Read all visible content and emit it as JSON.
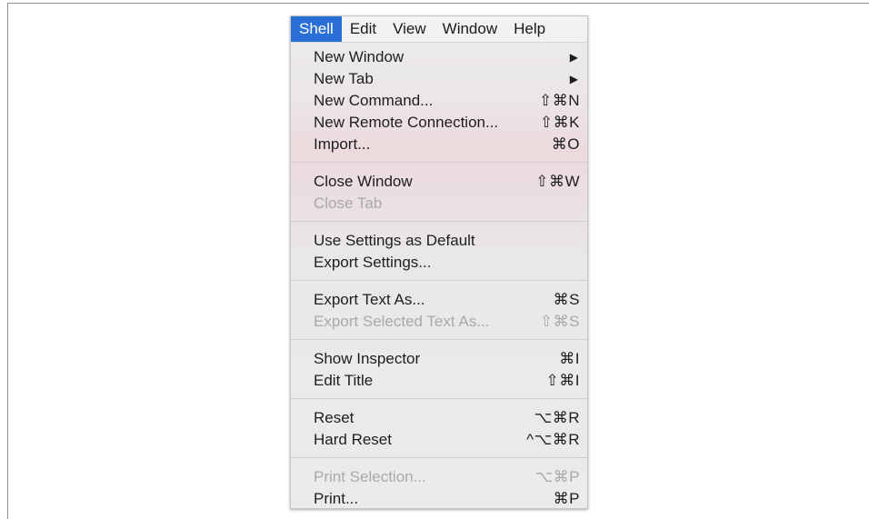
{
  "menubar": {
    "items": [
      {
        "label": "Shell",
        "active": true
      },
      {
        "label": "Edit",
        "active": false
      },
      {
        "label": "View",
        "active": false
      },
      {
        "label": "Window",
        "active": false
      },
      {
        "label": "Help",
        "active": false
      }
    ]
  },
  "shell_menu": {
    "groups": [
      [
        {
          "label": "New Window",
          "shortcut": "▶",
          "submenu": true,
          "disabled": false
        },
        {
          "label": "New Tab",
          "shortcut": "▶",
          "submenu": true,
          "disabled": false
        },
        {
          "label": "New Command...",
          "shortcut": "⇧⌘N",
          "disabled": false
        },
        {
          "label": "New Remote Connection...",
          "shortcut": "⇧⌘K",
          "disabled": false
        },
        {
          "label": "Import...",
          "shortcut": "⌘O",
          "disabled": false
        }
      ],
      [
        {
          "label": "Close Window",
          "shortcut": "⇧⌘W",
          "disabled": false
        },
        {
          "label": "Close Tab",
          "shortcut": "",
          "disabled": true
        }
      ],
      [
        {
          "label": "Use Settings as Default",
          "shortcut": "",
          "disabled": false
        },
        {
          "label": "Export Settings...",
          "shortcut": "",
          "disabled": false
        }
      ],
      [
        {
          "label": "Export Text As...",
          "shortcut": "⌘S",
          "disabled": false
        },
        {
          "label": "Export Selected Text As...",
          "shortcut": "⇧⌘S",
          "disabled": true
        }
      ],
      [
        {
          "label": "Show Inspector",
          "shortcut": "⌘I",
          "disabled": false
        },
        {
          "label": "Edit Title",
          "shortcut": "⇧⌘I",
          "disabled": false
        }
      ],
      [
        {
          "label": "Reset",
          "shortcut": "⌥⌘R",
          "disabled": false
        },
        {
          "label": "Hard Reset",
          "shortcut": "^⌥⌘R",
          "disabled": false
        }
      ],
      [
        {
          "label": "Print Selection...",
          "shortcut": "⌥⌘P",
          "disabled": true
        },
        {
          "label": "Print...",
          "shortcut": "⌘P",
          "disabled": false
        }
      ]
    ]
  },
  "colors": {
    "highlight": "#2a6fd6",
    "text": "#1e1e1e",
    "disabled_text": "#a9a9a9"
  }
}
